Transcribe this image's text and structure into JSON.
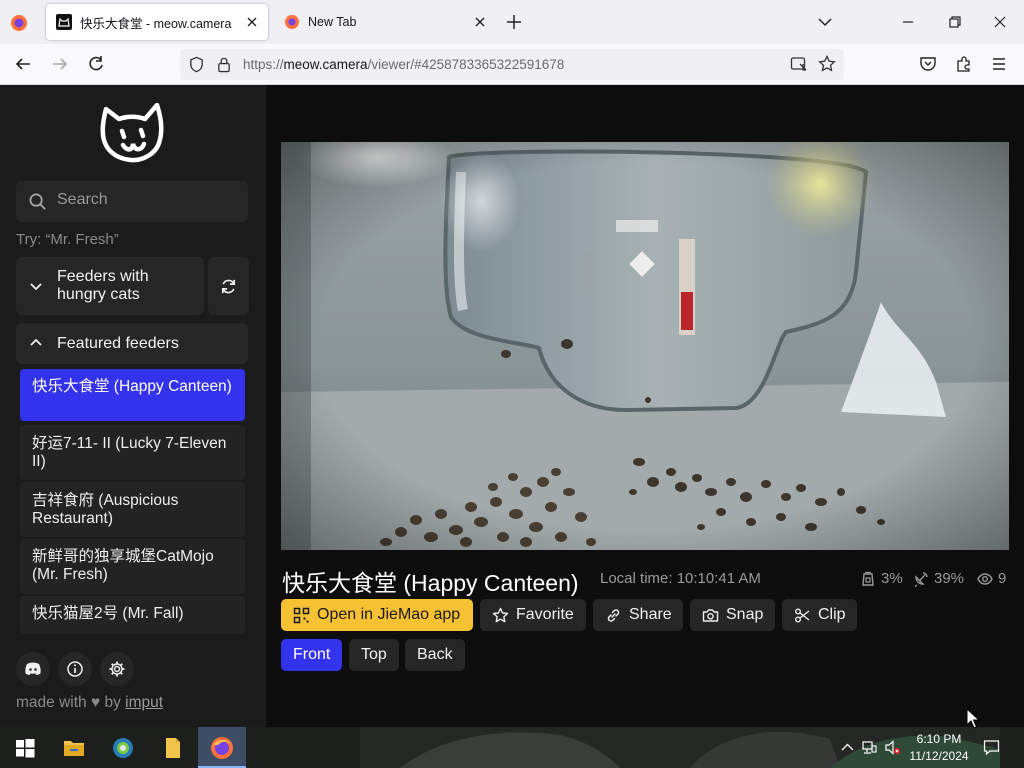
{
  "browser": {
    "tabs": [
      {
        "title": "快乐大食堂 - meow.camera",
        "active": true
      },
      {
        "title": "New Tab",
        "active": false
      }
    ],
    "url": {
      "scheme": "https://",
      "host": "meow.camera",
      "path": "/viewer/#4258783365322591678"
    }
  },
  "sidebar": {
    "search_placeholder": "Search",
    "try_hint": "Try: “Mr. Fresh”",
    "groups": {
      "hungry": "Feeders with hungry cats",
      "featured": "Featured feeders"
    },
    "feeders": [
      {
        "label": "快乐大食堂 (Happy Canteen)",
        "active": true
      },
      {
        "label": "好运7-11- II (Lucky 7-Eleven II)",
        "active": false
      },
      {
        "label": "吉祥食府 (Auspicious Restaurant)",
        "active": false
      },
      {
        "label": "新鲜哥的独享城堡CatMojo (Mr. Fresh)",
        "active": false
      },
      {
        "label": "快乐猫屋2号 (Mr. Fall)",
        "active": false
      }
    ],
    "footer": {
      "made_with": "made with",
      "by": "by",
      "author": "imput"
    }
  },
  "camera": {
    "title": "快乐大食堂 (Happy Canteen)",
    "local_time": "Local time: 10:10:41 AM",
    "stats": {
      "food": "3%",
      "signal": "39%",
      "viewers": "9"
    }
  },
  "actions": {
    "open_app": "Open in JieMao app",
    "favorite": "Favorite",
    "share": "Share",
    "snap": "Snap",
    "clip": "Clip"
  },
  "views": [
    {
      "label": "Front",
      "selected": true
    },
    {
      "label": "Top",
      "selected": false
    },
    {
      "label": "Back",
      "selected": false
    }
  ],
  "taskbar": {
    "time": "6:10 PM",
    "date": "11/12/2024"
  },
  "colors": {
    "accent_blue": "#3333ee",
    "app_button_yellow": "#f6c234",
    "sidebar_bg": "#1b1b1b"
  }
}
